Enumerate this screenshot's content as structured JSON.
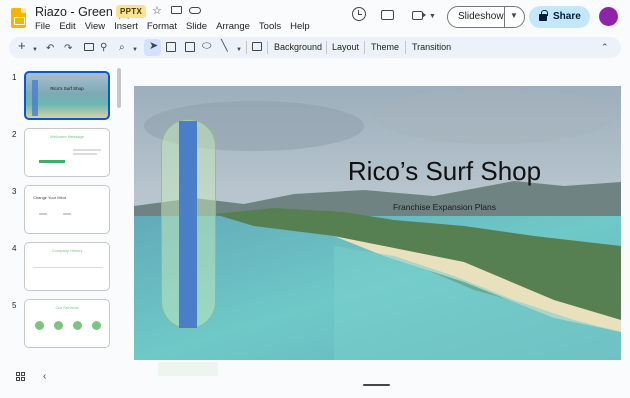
{
  "titlebar": {
    "doc_title": "Riazo - Green (1)",
    "file_type_badge": "PPTX",
    "slideshow_label": "Slideshow",
    "share_label": "Share"
  },
  "menu": [
    "File",
    "Edit",
    "View",
    "Insert",
    "Format",
    "Slide",
    "Arrange",
    "Tools",
    "Help"
  ],
  "toolbar": {
    "background_label": "Background",
    "layout_label": "Layout",
    "theme_label": "Theme",
    "transition_label": "Transition"
  },
  "filmstrip": {
    "slides": [
      {
        "number": "1",
        "title": "Rico's Surf Shop"
      },
      {
        "number": "2",
        "title": "Welcome Message"
      },
      {
        "number": "3",
        "title": "Change Your Mind"
      },
      {
        "number": "4",
        "title": "Company History"
      },
      {
        "number": "5",
        "title": "Our Services"
      }
    ]
  },
  "slide": {
    "title": "Rico’s Surf Shop",
    "subtitle": "Franchise Expansion Plans"
  },
  "colors": {
    "accent_blue": "#0b57d0",
    "share_bg": "#c2e7ff",
    "badge_bg": "#fde293",
    "avatar": "#8e24aa",
    "slide_green": "#7cc47f"
  }
}
